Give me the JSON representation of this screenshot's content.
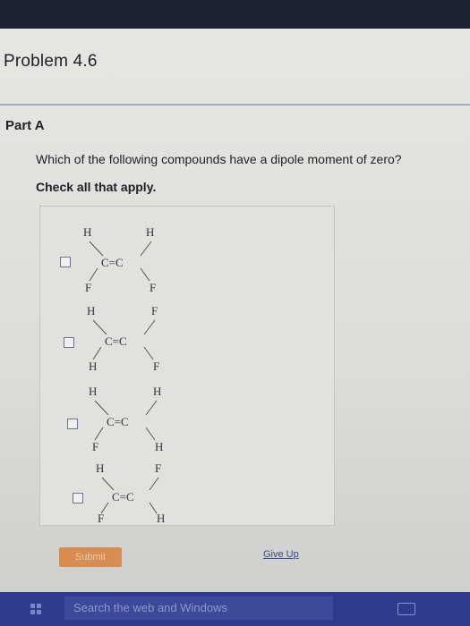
{
  "problem": {
    "title": "Problem 4.6"
  },
  "part": {
    "label": "Part A",
    "question": "Which of the following compounds have a dipole moment of zero?",
    "instruction": "Check all that apply."
  },
  "options": [
    {
      "top_left": "H",
      "top_right": "H",
      "bottom_left": "F",
      "bottom_right": "F",
      "core": "C=C"
    },
    {
      "top_left": "H",
      "top_right": "F",
      "bottom_left": "H",
      "bottom_right": "F",
      "core": "C=C"
    },
    {
      "top_left": "H",
      "top_right": "H",
      "bottom_left": "F",
      "bottom_right": "H",
      "core": "C=C"
    },
    {
      "top_left": "H",
      "top_right": "F",
      "bottom_left": "F",
      "bottom_right": "H",
      "core": "C=C"
    }
  ],
  "actions": {
    "submit_label": "Submit",
    "give_up_label": "Give Up"
  },
  "taskbar": {
    "search_placeholder": "Search the web and Windows"
  },
  "colors": {
    "accent": "#d9813c",
    "link": "#3a4a8a",
    "taskbar": "#2f3c8e"
  }
}
